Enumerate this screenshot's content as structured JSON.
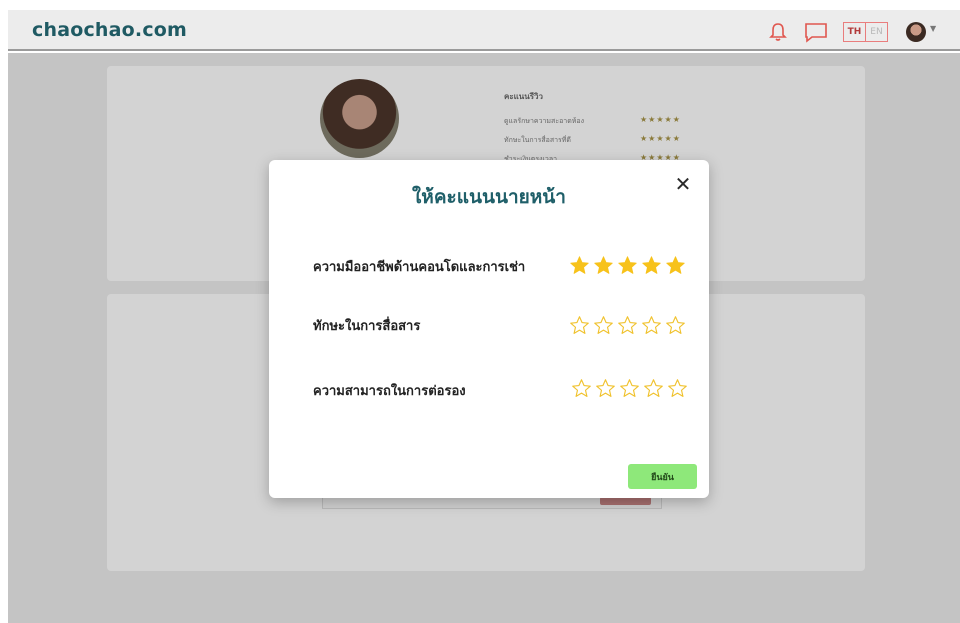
{
  "header": {
    "logo": "chaochao.com",
    "lang_th": "TH",
    "lang_en": "EN"
  },
  "icons": {
    "bell": "bell-icon",
    "chat": "chat-icon",
    "avatar": "avatar",
    "caret": "chevron-down-icon",
    "close": "close-icon",
    "star": "star-icon"
  },
  "background": {
    "review_title": "คะแนนรีวิว",
    "review_items": [
      {
        "label": "ดูแลรักษาความสะอาดห้อง",
        "rating": 5
      },
      {
        "label": "ทักษะในการสื่อสารที่ดี",
        "rating": 5
      },
      {
        "label": "ชำระเงินตรงเวลา",
        "rating": 5
      }
    ]
  },
  "modal": {
    "title": "ให้คะแนนนายหน้า",
    "criteria": [
      {
        "label": "ความมืออาชีพด้านคอนโดและการเช่า",
        "rating": 5
      },
      {
        "label": "ทักษะในการสื่อสาร",
        "rating": 0
      },
      {
        "label": "ความสามารถในการต่อรอง",
        "rating": 0
      }
    ],
    "confirm_label": "ยืนยัน",
    "max_stars": 5
  },
  "colors": {
    "brand": "#1f5a63",
    "star_filled": "#f7c21b",
    "star_outline": "#f0c22e",
    "confirm_bg": "#8ee87a"
  }
}
